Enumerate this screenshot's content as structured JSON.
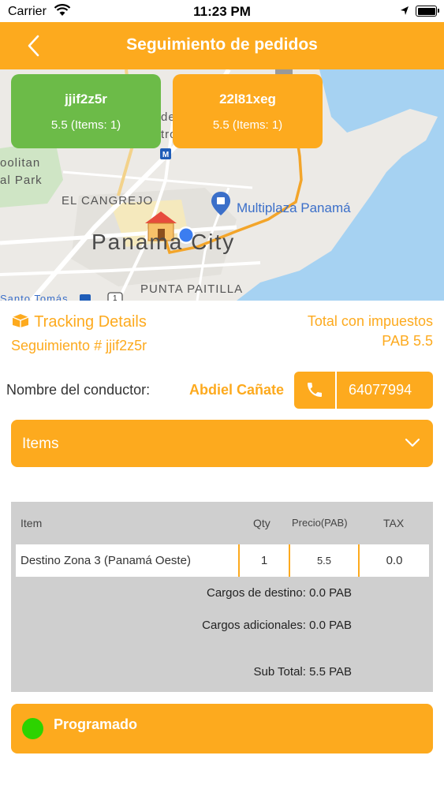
{
  "status_bar": {
    "carrier": "Carrier",
    "time": "11:23 PM"
  },
  "header": {
    "title": "Seguimiento de pedidos"
  },
  "map": {
    "labels": {
      "de": "de",
      "tro": "tro",
      "metro": "M",
      "bolitan": "oolitan",
      "park": "al Park",
      "cangrejo": "EL CANGREJO",
      "city": "Panama City",
      "poi": "Multiplaza Panamá",
      "paitilla": "PUNTA PAITILLA",
      "santo_tomas": "Santo Tomás",
      "route_number": "1"
    },
    "orders": [
      {
        "code": "jjif2z5r",
        "info": "5.5 (Items: 1)",
        "color": "#6cbb48"
      },
      {
        "code": "22l81xeg",
        "info": "5.5 (Items: 1)",
        "color": "#fdaa1e"
      }
    ]
  },
  "tracking": {
    "title": "Tracking Details",
    "number": "Seguimiento # jjif2z5r",
    "total_label": "Total con impuestos",
    "total_value": "PAB 5.5"
  },
  "driver": {
    "label": "Nombre del conductor:",
    "name": "Abdiel Cañate",
    "phone": "64077994"
  },
  "items_section": {
    "label": "Items"
  },
  "table": {
    "headers": {
      "item": "Item",
      "qty": "Qty",
      "price": "Precio(PAB)",
      "tax": "TAX"
    },
    "rows": [
      {
        "item": "Destino Zona 3 (Panamá Oeste)",
        "qty": "1",
        "price": "5.5",
        "tax": "0.0"
      }
    ],
    "destination_charges": "Cargos de destino: 0.0 PAB",
    "additional_charges": "Cargos adicionales: 0.0 PAB",
    "subtotal": "Sub Total: 5.5 PAB"
  },
  "order_status": {
    "label": "Programado",
    "color": "#2dd300"
  },
  "colors": {
    "accent": "#fdaa1e",
    "green": "#6cbb48"
  }
}
